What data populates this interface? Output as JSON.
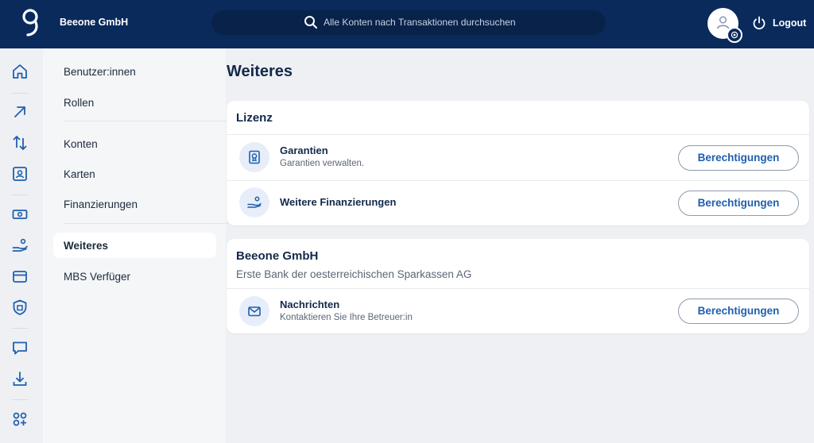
{
  "header": {
    "company": "Beeone GmbH",
    "search_placeholder": "Alle Konten nach Transaktionen durchsuchen",
    "logout_label": "Logout",
    "background_color": "#0a2a5c"
  },
  "rail": {
    "icons": [
      "home-icon",
      "arrow-up-right-icon",
      "transfer-arrows-icon",
      "contact-card-icon",
      "banknote-icon",
      "hand-money-icon",
      "card-icon",
      "shield-icon",
      "chat-icon",
      "download-icon",
      "apps-plus-icon"
    ]
  },
  "subnav": {
    "items": [
      {
        "label": "Benutzer:innen"
      },
      {
        "label": "Rollen"
      },
      {
        "label": "Konten"
      },
      {
        "label": "Karten"
      },
      {
        "label": "Finanzierungen"
      },
      {
        "label": "Weiteres",
        "active": true
      },
      {
        "label": "MBS Verfüger"
      }
    ]
  },
  "main": {
    "title": "Weiteres",
    "lizenz": {
      "title": "Lizenz",
      "rows": [
        {
          "title": "Garantien",
          "description": "Garantien verwalten.",
          "button": "Berechtigungen",
          "icon": "guarantee-icon"
        },
        {
          "title": "Weitere Finanzierungen",
          "description": "",
          "button": "Berechtigungen",
          "icon": "hand-money-icon"
        }
      ]
    },
    "company_card": {
      "title": "Beeone GmbH",
      "subtitle": "Erste Bank der oesterreichischen Sparkassen AG",
      "rows": [
        {
          "title": "Nachrichten",
          "description": "Kontaktieren Sie Ihre Betreuer:in",
          "button": "Berechtigungen",
          "icon": "mail-icon"
        }
      ]
    }
  },
  "colors": {
    "accent": "#1f5fb0",
    "icon_bg": "#e7eefa",
    "page_bg": "#eef0f3"
  }
}
